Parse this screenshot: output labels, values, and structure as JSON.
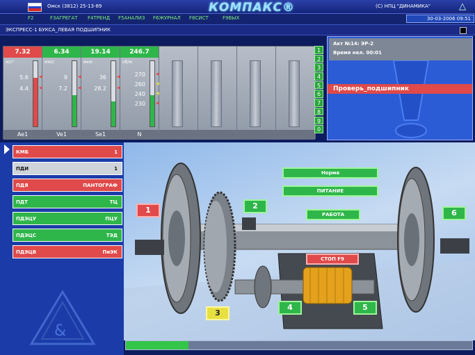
{
  "header": {
    "phone": "Омск (3812) 25-13-89",
    "logo": "КОМПАКС®",
    "company": "(С) НПЦ \"ДИНАМИКА\"",
    "datetime": "30-03-2006 09:51"
  },
  "menu": [
    "F2",
    "F3АГРЕГАТ",
    "F4ТРЕНД",
    "F5АНАЛИЗ",
    "F6ЖУРНАЛ",
    "F8СИСТ",
    "F9ВЫХ"
  ],
  "title": "ЭКСПРЕСС-1 БУКСА_ЛЕВАЯ ПОДШИПНИК",
  "gauges": [
    {
      "value": "7.32",
      "unit": "м/с²",
      "ticks": [
        "5.6",
        "4.4"
      ],
      "name": "Ae1",
      "level": 0.74,
      "header_color": "#e04a4a",
      "bar_color": "#e04a4a"
    },
    {
      "value": "6.34",
      "unit": "мм/с",
      "ticks": [
        "9",
        "7.2"
      ],
      "name": "Ve1",
      "level": 0.48,
      "header_color": "#2fb64a",
      "bar_color": "#2fb64a"
    },
    {
      "value": "19.14",
      "unit": "мкм",
      "ticks": [
        "36",
        "28.2"
      ],
      "name": "Se1",
      "level": 0.38,
      "header_color": "#2fb64a",
      "bar_color": "#2fb64a"
    },
    {
      "value": "246.7",
      "unit": "об/м",
      "ticks": [
        "270",
        "260",
        "240",
        "230"
      ],
      "name": "N",
      "level": 0.48,
      "header_color": "#2fb64a",
      "bar_color": "#2fb64a"
    }
  ],
  "channels": [
    "1",
    "2",
    "3",
    "4",
    "5",
    "6",
    "7",
    "8",
    "9",
    "0"
  ],
  "act": {
    "line1": "Акт №14: ЭР-2",
    "line2": "Время нел. 00:01",
    "alert": "Проверь_подшипник"
  },
  "sensors": [
    {
      "label": "КМБ",
      "value": "1",
      "color": "#e04a4a"
    },
    {
      "label": "ПДИ",
      "value": "1",
      "color": "#cfd3da"
    },
    {
      "label": "ПДЯ",
      "value": "ПАНТОГРАФ",
      "color": "#e04a4a"
    },
    {
      "label": "ПДТ",
      "value": "ТЦ",
      "color": "#2fb64a"
    },
    {
      "label": "ПДЭЦУ",
      "value": "ПЦУ",
      "color": "#2fb64a"
    },
    {
      "label": "ПДЭЦС",
      "value": "ТЭД",
      "color": "#2fb64a"
    },
    {
      "label": "ПДЭЦВ",
      "value": "ПиЭК",
      "color": "#e04a4a"
    }
  ],
  "scene": {
    "status": [
      "Норма",
      "ПИТАНИЕ",
      "РАБОТА"
    ],
    "stop": "СТОП F9",
    "points": [
      "1",
      "2",
      "3",
      "4",
      "5",
      "6"
    ]
  },
  "progress": 0.18
}
